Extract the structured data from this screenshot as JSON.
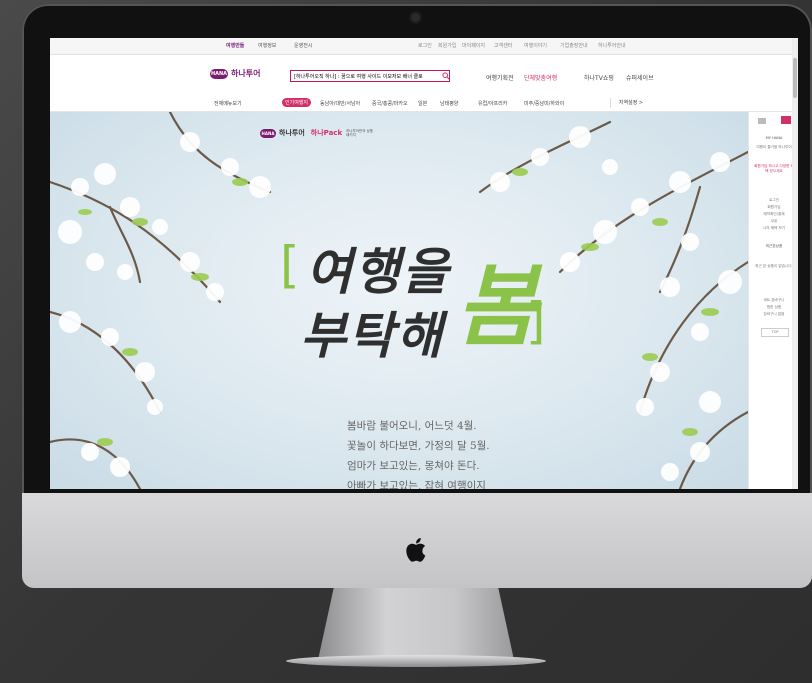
{
  "browser": {
    "top_tabs": [
      "여행만들",
      "여행정보",
      "운영전시"
    ],
    "utility_links": [
      "로그인",
      "회원가입",
      "마이페이지",
      "고객센터",
      "여행이야기",
      "기업출장안내",
      "하나투어안내"
    ]
  },
  "header": {
    "logo_mark": "HANA",
    "logo_text": "하나투어",
    "search_text": "[하나투어오직 하나] : 꿈으로 여행 사이드 이모저모 배너 클로",
    "links": [
      "여행기획전",
      "단체맞춤여행",
      "하나TV쇼핑",
      "슈퍼세이브"
    ]
  },
  "menu": {
    "all_menu": "전체메뉴보기",
    "badge": "인기여행지",
    "items": [
      "동남아/대만/서남아",
      "중국/홍콩/마카오",
      "일본",
      "남태평양",
      "유럽/아프리카",
      "미주/중남미/하와이"
    ],
    "region": "지역설정 >"
  },
  "hero": {
    "brand_mark": "HANA",
    "brand_name": "하나투어",
    "brand_pack": "하나Pack",
    "brand_sub": "하나투어만의 상품 패키지",
    "headline_line1": "여행을",
    "headline_line2": "부탁해",
    "headline_accent": "봄",
    "copy": [
      "봄바람 불어오니, 어느덧 4월.",
      "꽃놀이 하다보면, 가정의 달 5월.",
      "엄마가 보고있는, 몽쳐야 돈다.",
      "아빠가 보고있는, 잡혀 여행이지"
    ]
  },
  "rail": {
    "title": "MY HANA",
    "items": [
      "여행이 즐거움 하나투어",
      "회원가입 하시고 다양한 혜택 받으세요",
      "로그인",
      "회원가입",
      "예약확인/결제",
      "쿠폰",
      "나의 혜택 보기",
      "최근본상품",
      "최근 본 상품이 없습니다.",
      "세트 장바구니",
      "찜한 상품",
      "장바구니 없음"
    ],
    "top_button": "TOP"
  },
  "colors": {
    "brand_purple": "#7b1d6f",
    "accent_pink": "#d12f6a",
    "spring_green": "#8bc34a"
  }
}
